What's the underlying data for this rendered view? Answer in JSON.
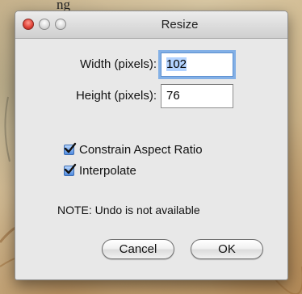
{
  "background": {
    "visible_text": "ng"
  },
  "dialog": {
    "title": "Resize",
    "window_controls": {
      "close": "close-icon",
      "minimize": "minimize-icon",
      "zoom": "zoom-icon"
    },
    "fields": {
      "width_label": "Width (pixels):",
      "width_value": "102",
      "height_label": "Height (pixels):",
      "height_value": "76"
    },
    "options": {
      "constrain_label": "Constrain Aspect Ratio",
      "constrain_checked": true,
      "interpolate_label": "Interpolate",
      "interpolate_checked": true
    },
    "note": "NOTE: Undo is not available",
    "buttons": {
      "cancel_label": "Cancel",
      "ok_label": "OK"
    }
  },
  "colors": {
    "close_button": "#e2463b",
    "focus_ring": "#83b0e6",
    "checkbox": "#4f8be0"
  }
}
